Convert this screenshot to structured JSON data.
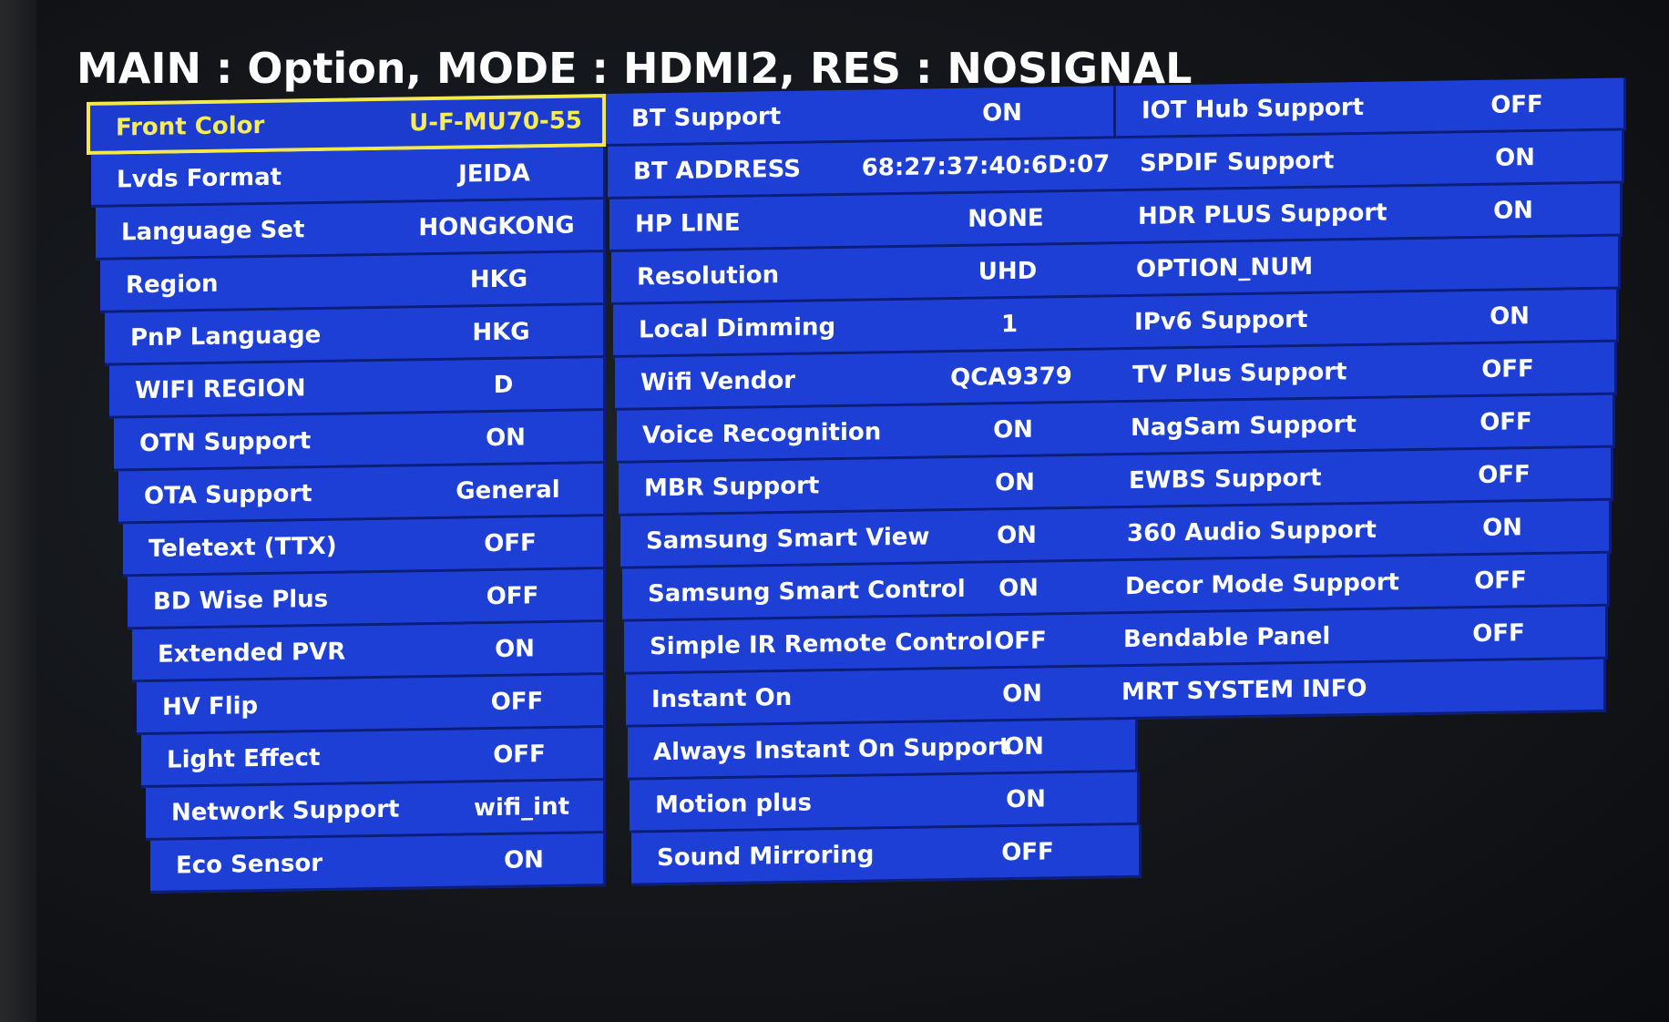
{
  "header": {
    "title": "MAIN : Option, MODE : HDMI2, RES : NOSIGNAL"
  },
  "colors": {
    "row_background": "#1e3fd6",
    "row_border": "#0d1e7a",
    "selected_border": "#f4e94a",
    "selected_text": "#f6ec5a",
    "text": "#ffffff"
  },
  "columns": [
    {
      "items": [
        {
          "label": "Front Color",
          "value": "U-F-MU70-55",
          "selected": true
        },
        {
          "label": "Lvds Format",
          "value": "JEIDA"
        },
        {
          "label": "Language Set",
          "value": "HONGKONG"
        },
        {
          "label": "Region",
          "value": "HKG"
        },
        {
          "label": "PnP Language",
          "value": "HKG"
        },
        {
          "label": "WIFI REGION",
          "value": "D"
        },
        {
          "label": "OTN Support",
          "value": "ON"
        },
        {
          "label": "OTA Support",
          "value": "General"
        },
        {
          "label": "Teletext (TTX)",
          "value": "OFF"
        },
        {
          "label": "BD Wise Plus",
          "value": "OFF"
        },
        {
          "label": "Extended PVR",
          "value": "ON"
        },
        {
          "label": "HV Flip",
          "value": "OFF"
        },
        {
          "label": "Light Effect",
          "value": "OFF"
        },
        {
          "label": "Network Support",
          "value": "wifi_int"
        },
        {
          "label": "Eco Sensor",
          "value": "ON"
        }
      ]
    },
    {
      "items": [
        {
          "label": "BT Support",
          "value": "ON"
        },
        {
          "label": "BT ADDRESS",
          "value": "68:27:37:40:6D:07"
        },
        {
          "label": "HP LINE",
          "value": "NONE"
        },
        {
          "label": "Resolution",
          "value": "UHD"
        },
        {
          "label": "Local Dimming",
          "value": "1"
        },
        {
          "label": "Wifi Vendor",
          "value": "QCA9379"
        },
        {
          "label": "Voice Recognition",
          "value": "ON"
        },
        {
          "label": "MBR Support",
          "value": "ON"
        },
        {
          "label": "Samsung Smart View",
          "value": "ON"
        },
        {
          "label": "Samsung Smart Control",
          "value": "ON"
        },
        {
          "label": "Simple IR Remote Control",
          "value": "OFF"
        },
        {
          "label": "Instant On",
          "value": "ON"
        },
        {
          "label": "Always Instant On Support",
          "value": "ON"
        },
        {
          "label": "Motion plus",
          "value": "ON"
        },
        {
          "label": "Sound Mirroring",
          "value": "OFF"
        }
      ]
    },
    {
      "items": [
        {
          "label": "IOT Hub Support",
          "value": "OFF"
        },
        {
          "label": "SPDIF Support",
          "value": "ON"
        },
        {
          "label": "HDR PLUS Support",
          "value": "ON"
        },
        {
          "label": "OPTION_NUM",
          "value": ""
        },
        {
          "label": "IPv6 Support",
          "value": "ON"
        },
        {
          "label": "TV Plus Support",
          "value": "OFF"
        },
        {
          "label": "NagSam Support",
          "value": "OFF"
        },
        {
          "label": "EWBS Support",
          "value": "OFF"
        },
        {
          "label": "360 Audio Support",
          "value": "ON"
        },
        {
          "label": "Decor Mode Support",
          "value": "OFF"
        },
        {
          "label": "Bendable Panel",
          "value": "OFF"
        },
        {
          "label": "MRT SYSTEM INFO",
          "value": ""
        }
      ]
    }
  ]
}
